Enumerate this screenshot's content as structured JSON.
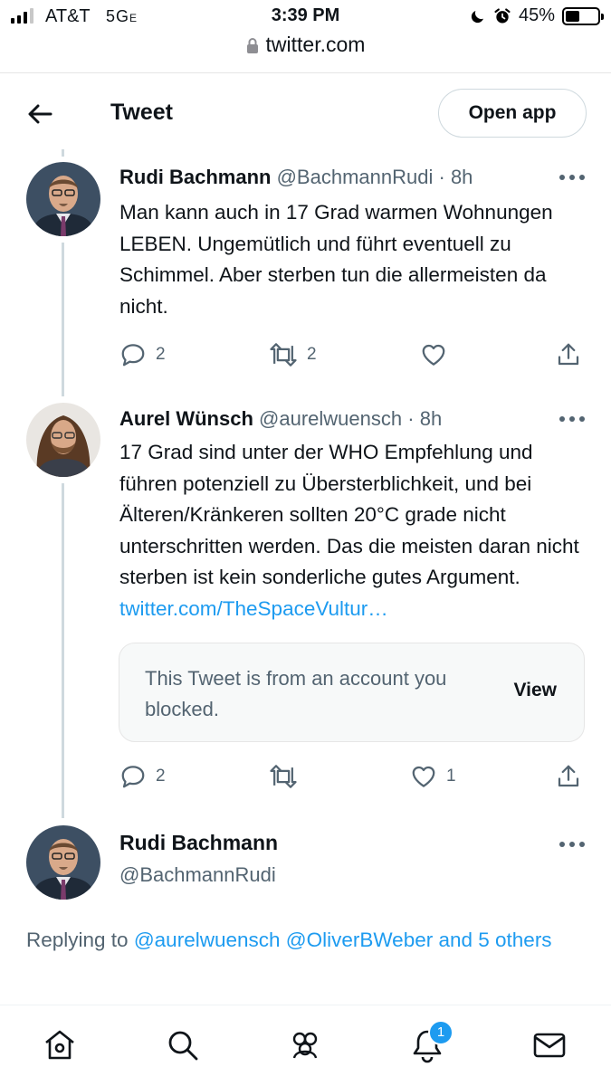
{
  "status_bar": {
    "carrier": "AT&T",
    "network": "5G",
    "network_suffix": "E",
    "time": "3:39 PM",
    "battery": "45%",
    "battery_level": 0.45
  },
  "browser": {
    "url": "twitter.com"
  },
  "header": {
    "title": "Tweet",
    "open_app_label": "Open app"
  },
  "tweets": [
    {
      "name": "Rudi Bachmann",
      "handle": "@BachmannRudi",
      "separator": "·",
      "time": "8h",
      "text": "Man kann auch in 17 Grad warmen Wohnungen LEBEN. Ungemütlich und führt eventuell zu Schimmel. Aber sterben tun die allermeisten da nicht.",
      "replies": "2",
      "retweets": "2",
      "likes": ""
    },
    {
      "name": "Aurel Wünsch",
      "handle": "@aurelwuensch",
      "separator": "·",
      "time": "8h",
      "text": "17 Grad sind unter der WHO Empfehlung und führen potenziell zu Übersterblichkeit, und bei Älteren/Kränkeren sollten 20°C  grade nicht unterschritten werden. Das die meisten daran nicht sterben ist kein sonderliche gutes Argument.",
      "link": "twitter.com/TheSpaceVultur…",
      "quoted": {
        "text": "This Tweet is from an account you blocked.",
        "action": "View"
      },
      "replies": "2",
      "retweets": "",
      "likes": "1"
    }
  ],
  "reply": {
    "name": "Rudi Bachmann",
    "handle": "@BachmannRudi",
    "replying_prefix": "Replying to ",
    "mentions": "@aurelwuensch @OliverBWeber and 5 others"
  },
  "tabbar": {
    "notifications_badge": "1"
  },
  "colors": {
    "accent": "#1d9bf0",
    "secondary_text": "#536471",
    "primary_text": "#0f1419"
  }
}
